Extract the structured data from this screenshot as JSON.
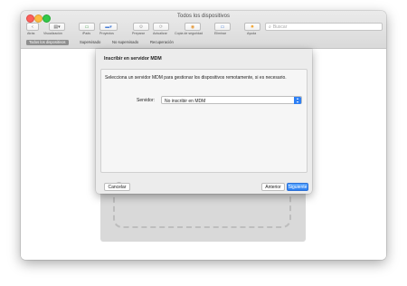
{
  "window": {
    "title": "Todos los dispositivos"
  },
  "toolbar": {
    "items": [
      {
        "label": "Atrás",
        "icon": "chevron-left-icon"
      },
      {
        "label": "Visualización",
        "icon": "view-icon"
      },
      {
        "label": "iPads",
        "icon": "ipad-icon"
      },
      {
        "label": "Proyectos",
        "icon": "projects-icon"
      },
      {
        "label": "Preparar",
        "icon": "prepare-icon"
      },
      {
        "label": "Actualizar",
        "icon": "update-icon"
      },
      {
        "label": "Copia de seguridad",
        "icon": "backup-icon"
      },
      {
        "label": "Eliminar",
        "icon": "trash-icon"
      },
      {
        "label": "Ayuda",
        "icon": "help-icon"
      }
    ],
    "search_placeholder": "Buscar"
  },
  "tabs": [
    {
      "label": "Todos los dispositivos",
      "active": true
    },
    {
      "label": "Supervisado",
      "active": false
    },
    {
      "label": "No supervisado",
      "active": false
    },
    {
      "label": "Recuperación",
      "active": false
    }
  ],
  "sheet": {
    "title": "Inscribir en servidor MDM",
    "description": "Selecciona un servidor MDM para gestionar los dispositivos remotamente, si es necesario.",
    "server_label": "Servidor:",
    "server_value": "No inscribir en MDM",
    "help_label": "?",
    "cancel_label": "Cancelar",
    "previous_label": "Anterior",
    "next_label": "Siguiente"
  },
  "colors": {
    "accent": "#2c7ff0",
    "close": "#fc605b",
    "minimize": "#fdbc40",
    "zoom": "#34c84a"
  }
}
